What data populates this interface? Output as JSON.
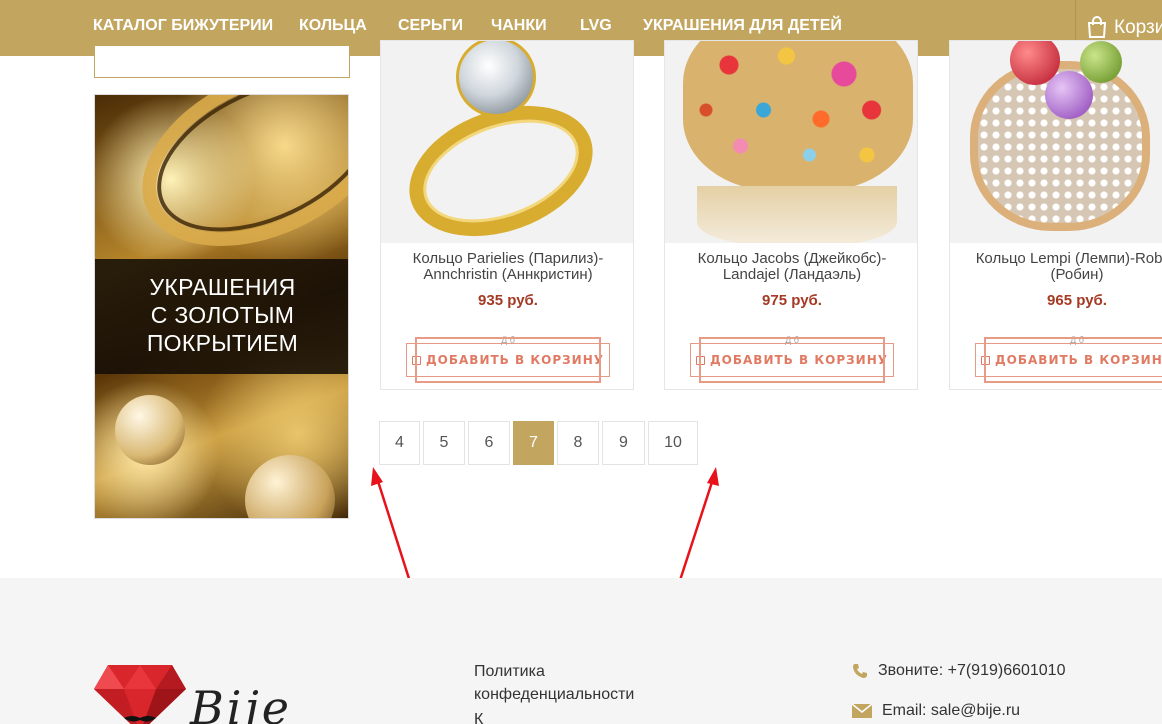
{
  "nav": {
    "items": [
      "КАТАЛОГ БИЖУТЕРИИ",
      "КОЛЬЦА",
      "СЕРЬГИ",
      "ЧАНКИ",
      "LVG",
      "УКРАШЕНИЯ ДЛЯ ДЕТЕЙ"
    ],
    "cart_label": "Корзина"
  },
  "sidebar": {
    "banner_lines": [
      "УКРАШЕНИЯ",
      "С ЗОЛОТЫМ",
      "ПОКРЫТИЕМ"
    ]
  },
  "products": [
    {
      "name": "Кольцо Parielies (Парилиз)-Annchristin (Аннкристин)",
      "price": "935 руб.",
      "button": "ДОБАВИТЬ В КОРЗИНУ",
      "ghost": "Д б"
    },
    {
      "name": "Кольцо Jacobs (Джейкобс)-Landajel (Ландаэль)",
      "price": "975 руб.",
      "button": "ДОБАВИТЬ В КОРЗИНУ",
      "ghost": "Д б"
    },
    {
      "name": "Кольцо Lempi (Лемпи)-Robyn (Робин)",
      "price": "965 руб.",
      "button": "ДОБАВИТЬ В КОРЗИНУ",
      "ghost": "Д б"
    }
  ],
  "pagination": {
    "pages": [
      "4",
      "5",
      "6",
      "7",
      "8",
      "9",
      "10"
    ],
    "current": "7"
  },
  "footer": {
    "logo_text": "Bije",
    "links": [
      "Политика конфеденциальности",
      "К"
    ],
    "phone": "Звоните: +7(919)6601010",
    "email": "Email: sale@bije.ru"
  },
  "colors": {
    "brand": "#c2a660",
    "price": "#a53a24",
    "button": "#e07a62",
    "arrow": "#e8121b",
    "gem": "#d9262c"
  },
  "icons": {
    "cart": "shopping-bag-icon",
    "phone": "phone-icon",
    "email": "envelope-icon",
    "logo": "ruby-gem-icon"
  }
}
